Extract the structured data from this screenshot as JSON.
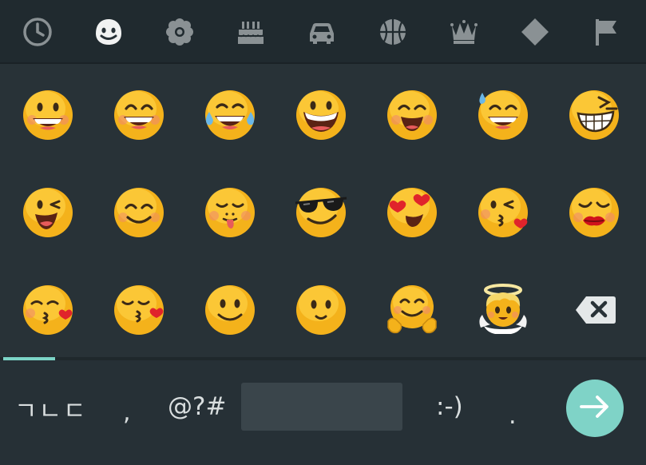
{
  "category_tabs": [
    {
      "icon": "recent-clock-icon"
    },
    {
      "icon": "smiley-face-icon",
      "active": true
    },
    {
      "icon": "flower-icon"
    },
    {
      "icon": "birthday-cake-icon"
    },
    {
      "icon": "car-icon"
    },
    {
      "icon": "basketball-icon"
    },
    {
      "icon": "crown-icon"
    },
    {
      "icon": "diamond-icon"
    },
    {
      "icon": "flag-icon"
    }
  ],
  "emoji_rows": [
    [
      "grinning-face",
      "grinning-smiling-eyes",
      "tears-of-joy",
      "grinning-squinting",
      "smiling-open-mouth",
      "grinning-sweat",
      "beaming-squint"
    ],
    [
      "winking-tongue",
      "smiling-eyes",
      "savoring-tongue",
      "cool-sunglasses",
      "heart-eyes",
      "kissing-heart",
      "red-lips-kiss"
    ],
    [
      "kissing-heart-eyes-closed",
      "kissing-closed-eyes-heart",
      "slightly-smiling",
      "smiling-face",
      "hugging-face",
      "angel-halo"
    ]
  ],
  "backspace": {
    "icon": "backspace-icon"
  },
  "page_progress": 0.08,
  "keyboard": {
    "language_label": "ㄱㄴㄷ",
    "comma": ",",
    "symbols_label": "@?#",
    "emoticon_label": ":-)",
    "period": "."
  },
  "enter": {
    "icon": "arrow-right-icon"
  },
  "colors": {
    "accent": "#7cd4c6",
    "background": "#263036",
    "tab_background": "#202a2f",
    "emoji_yellow": "#f4b21b"
  }
}
